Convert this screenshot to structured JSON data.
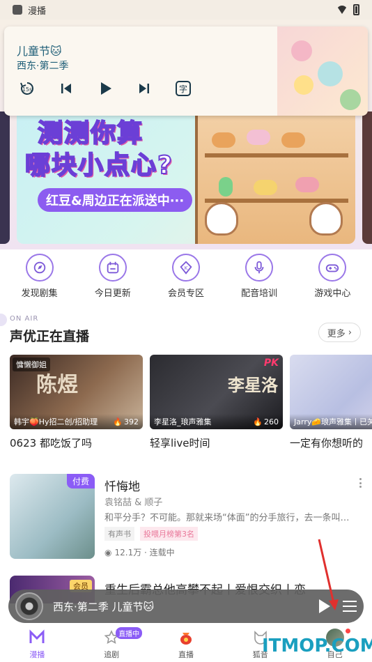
{
  "status_bar": {
    "app_name": "漫播"
  },
  "player": {
    "title": "儿童节🐱",
    "subtitle": "西东·第二季",
    "skip_label": "15s",
    "subtitle_btn": "字"
  },
  "banner": {
    "line1": "测测你算",
    "line2": "哪块小点心?",
    "pill": "红豆&周边正在派送中···"
  },
  "quick_nav": [
    {
      "label": "发现剧集",
      "icon": "discover-icon"
    },
    {
      "label": "今日更新",
      "icon": "calendar-icon"
    },
    {
      "label": "会员专区",
      "icon": "vip-icon"
    },
    {
      "label": "配音培训",
      "icon": "mic-icon"
    },
    {
      "label": "游戏中心",
      "icon": "gamepad-icon"
    }
  ],
  "live_section": {
    "onair": "ON AIR",
    "title": "声优正在直播",
    "more": "更多",
    "cards": [
      {
        "tag": "慵懒御姐",
        "host": "韩宇🍑Hy招二创/招助理",
        "count": "392",
        "caption": "0623 都吃饭了吗"
      },
      {
        "tag": "",
        "host": "李星洛_琅声雅集",
        "count": "260",
        "caption": "轻享live时间",
        "pk": "PK"
      },
      {
        "tag": "",
        "host": "Jarry🧀琅声雅集丨已关",
        "count": "",
        "caption": "一定有你想听的"
      }
    ]
  },
  "drama": {
    "badge": "付费",
    "title": "忏悔地",
    "author": "袁铭喆 & 顺子",
    "desc": "和平分手？不可能。那就来场“体面”的分手旅行，去一条叫…",
    "tag1": "有声书",
    "tag2": "投喂月榜第3名",
    "views": "12.1万 · 连载中"
  },
  "drama2": {
    "badge": "会员",
    "title": "重生后霸总他高攀不起丨爱恨交织丨恋"
  },
  "mini_player": {
    "title": "西东·第二季 儿童节🐱"
  },
  "tabs": [
    {
      "label": "漫播",
      "active": true
    },
    {
      "label": "追剧",
      "badge": "直播中"
    },
    {
      "label": "直播"
    },
    {
      "label": "狐音"
    },
    {
      "label": "自己"
    }
  ],
  "watermark": "ITMOP.COM"
}
